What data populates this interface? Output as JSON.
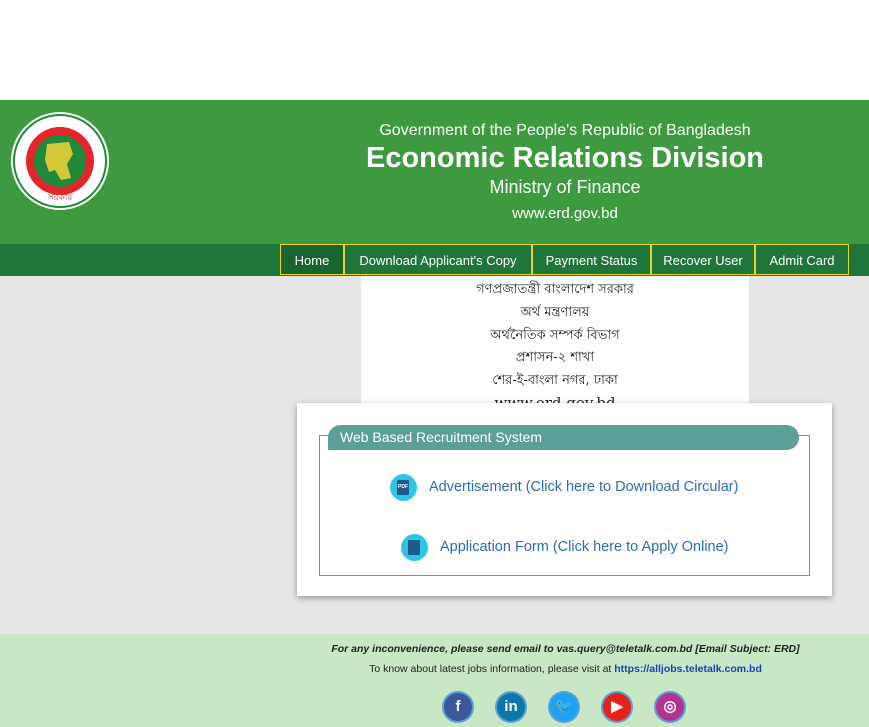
{
  "header": {
    "government": "Government of the People's Republic of Bangladesh",
    "title": "Economic Relations Division",
    "ministry": "Ministry of Finance",
    "website": "www.erd.gov.bd"
  },
  "nav": {
    "items": [
      {
        "label": "Home"
      },
      {
        "label": "Download Applicant's Copy"
      },
      {
        "label": "Payment Status"
      },
      {
        "label": "Recover User"
      },
      {
        "label": "Admit Card"
      }
    ]
  },
  "scan_banner": {
    "lines": [
      "গণপ্রজাতন্ত্রী বাংলাদেশ সরকার",
      "অর্থ মন্ত্রণালয়",
      "অর্থনৈতিক সম্পর্ক বিভাগ",
      "প্রশাসন-২ শাখা",
      "শের-ই-বাংলা নগর, ঢাকা",
      "www.erd.gov.bd"
    ]
  },
  "recruitment": {
    "title": "Web Based Recruitment System",
    "advertisement_link": "Advertisement (Click here to Download Circular)",
    "application_link": "Application Form (Click here to Apply Online)",
    "pdf_label": "PDF"
  },
  "footer": {
    "contact_text": "For any inconvenience, please send email to vas.query@teletalk.com.bd [Email Subject: ERD]",
    "jobs_text": "To know about latest jobs information, please visit at",
    "jobs_link": "https://alljobs.teletalk.com.bd"
  },
  "social": [
    {
      "name": "facebook-icon",
      "glyph": "f",
      "color": "#3b5998"
    },
    {
      "name": "linkedin-icon",
      "glyph": "in",
      "color": "#0e76a8"
    },
    {
      "name": "twitter-icon",
      "glyph": "🐦",
      "color": "#1da1f2"
    },
    {
      "name": "youtube-icon",
      "glyph": "▶",
      "color": "#e62117"
    },
    {
      "name": "instagram-icon",
      "glyph": "◎",
      "color": "#b5328f"
    }
  ]
}
